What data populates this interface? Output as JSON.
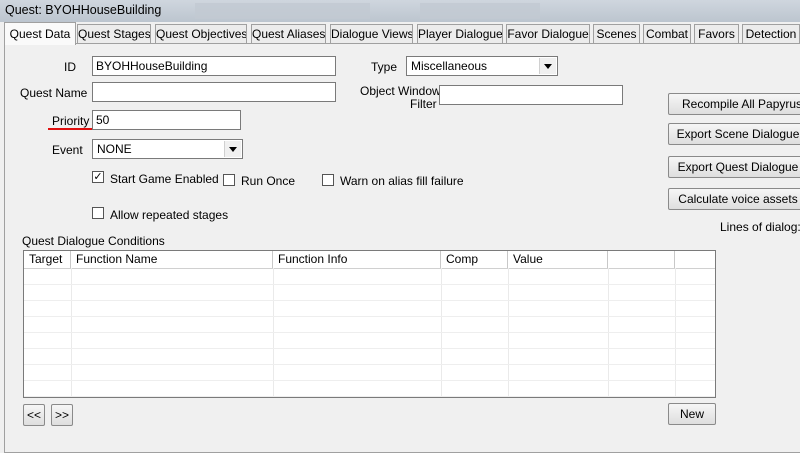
{
  "window": {
    "title": "Quest: BYOHHouseBuilding"
  },
  "tabs": [
    {
      "label": "Quest Data"
    },
    {
      "label": "Quest Stages"
    },
    {
      "label": "Quest Objectives"
    },
    {
      "label": "Quest Aliases"
    },
    {
      "label": "Dialogue Views"
    },
    {
      "label": "Player Dialogue"
    },
    {
      "label": "Favor Dialogue"
    },
    {
      "label": "Scenes"
    },
    {
      "label": "Combat"
    },
    {
      "label": "Favors"
    },
    {
      "label": "Detection"
    }
  ],
  "form": {
    "id_label": "ID",
    "id_value": "BYOHHouseBuilding",
    "quest_name_label": "Quest Name",
    "quest_name_value": "",
    "priority_label": "Priority",
    "priority_value": "50",
    "event_label": "Event",
    "event_value": "NONE",
    "type_label": "Type",
    "type_value": "Miscellaneous",
    "object_window_filter_label_1": "Object Window",
    "object_window_filter_label_2": "Filter",
    "object_window_filter_value": ""
  },
  "checkboxes": {
    "start_game_enabled": {
      "label": "Start Game Enabled",
      "checked": true
    },
    "run_once": {
      "label": "Run Once",
      "checked": false
    },
    "warn_alias": {
      "label": "Warn on alias fill failure",
      "checked": false
    },
    "allow_repeated": {
      "label": "Allow repeated stages",
      "checked": false
    }
  },
  "side_buttons": {
    "recompile": "Recompile All Papyrus Sc",
    "export_scene": "Export Scene Dialogue",
    "export_quest": "Export Quest Dialogue",
    "calc_voice": "Calculate voice assets",
    "lines_of_dialog": "Lines of dialog:"
  },
  "conditions": {
    "title": "Quest Dialogue Conditions",
    "columns": [
      "Target",
      "Function Name",
      "Function Info",
      "Comp",
      "Value",
      "",
      ""
    ],
    "rows": []
  },
  "bottom": {
    "prev": "<<",
    "next": ">>",
    "new": "New"
  },
  "colors": {
    "highlight_underline": "#e01010"
  }
}
